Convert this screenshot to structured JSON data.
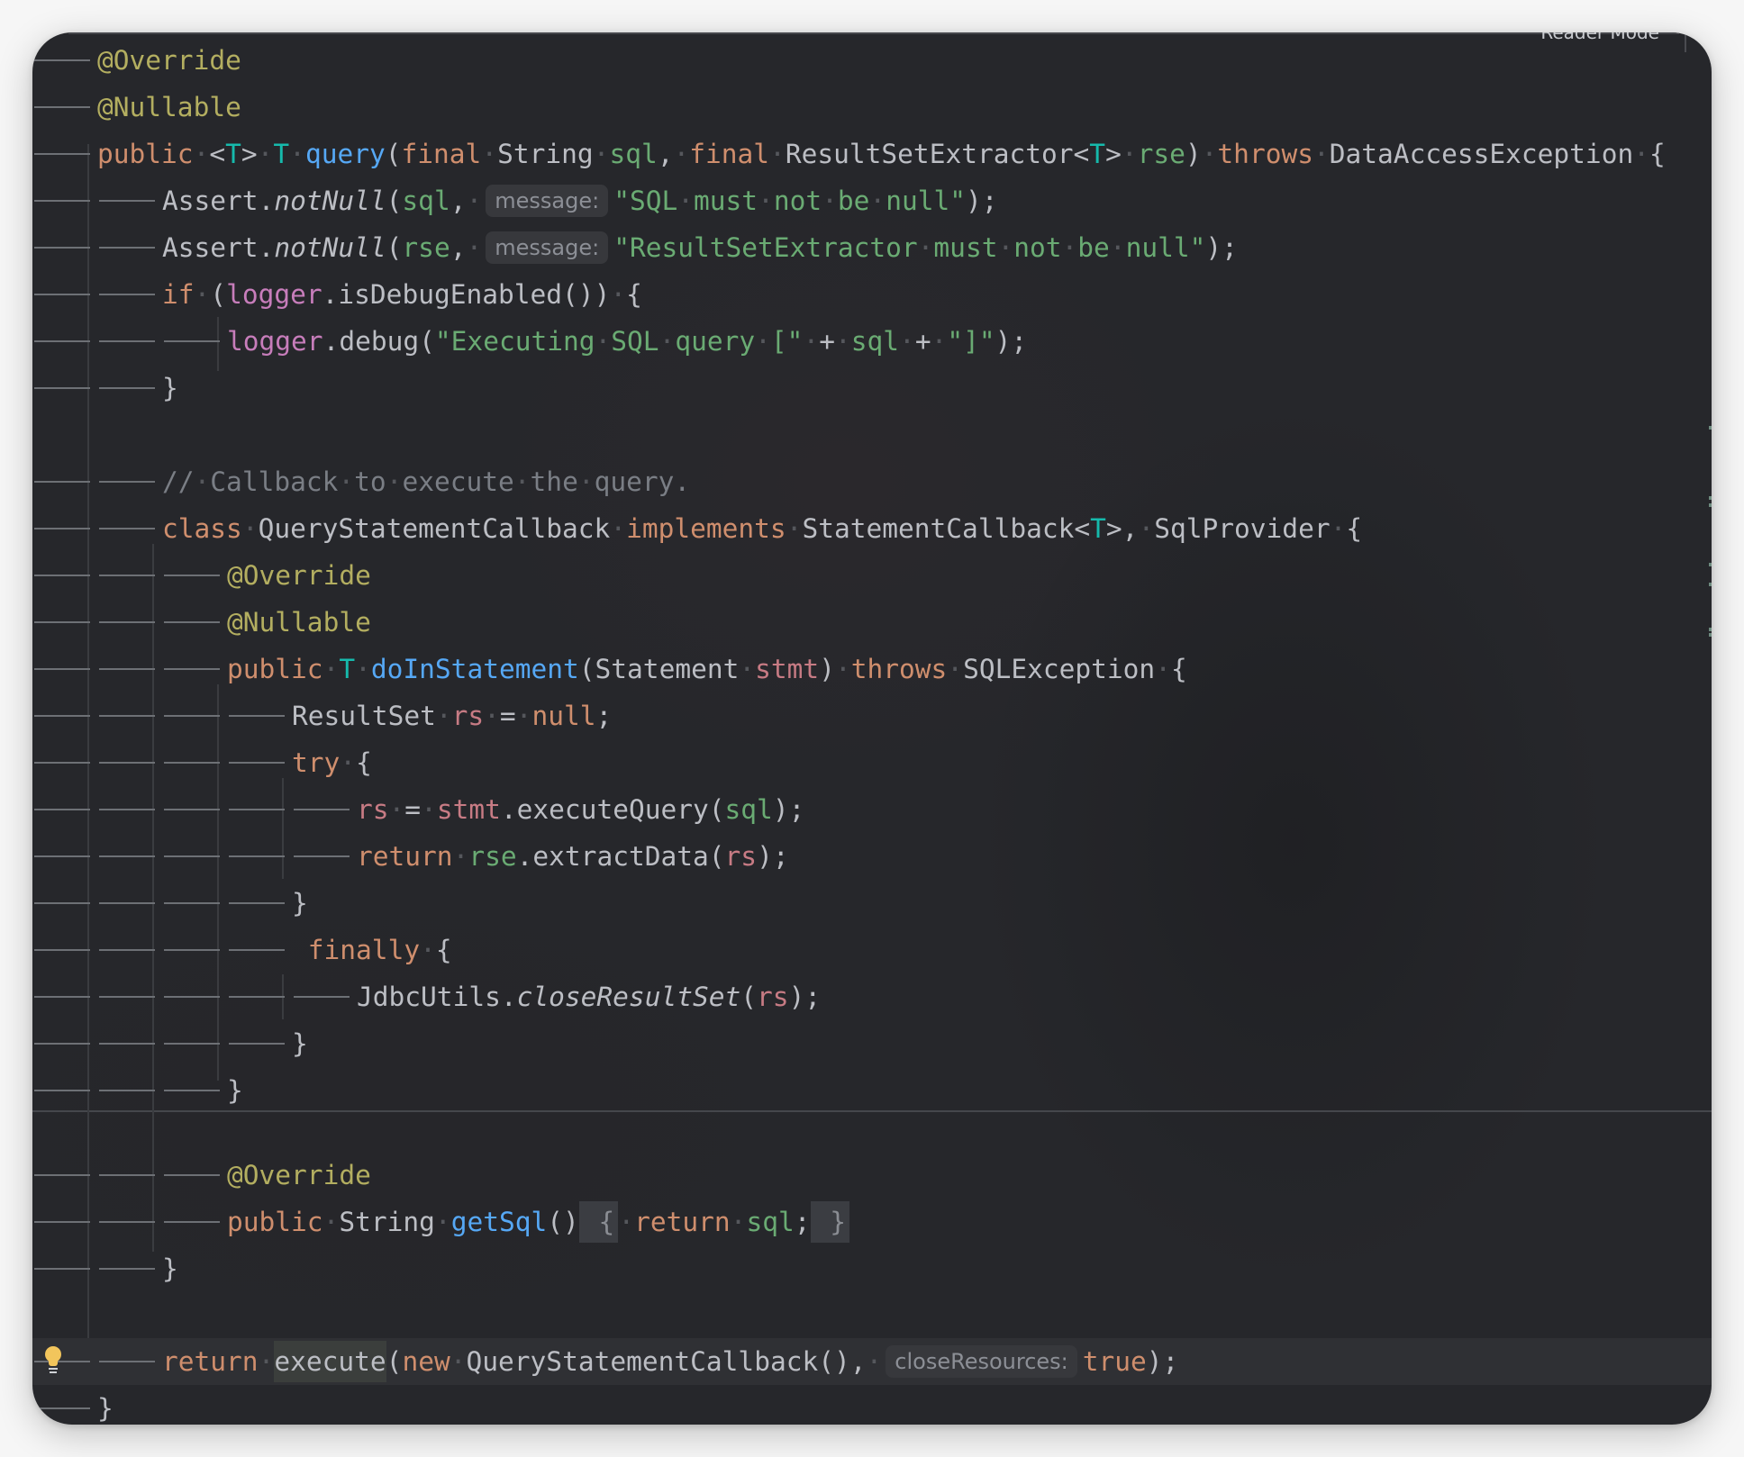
{
  "editor": {
    "reader_mode_label": "Reader Mode",
    "language": "Java",
    "whitespace_glyph": "·",
    "lines": [
      {
        "indent": 1,
        "tokens": [
          [
            "ann",
            "@Override"
          ]
        ]
      },
      {
        "indent": 1,
        "tokens": [
          [
            "ann",
            "@Nullable"
          ]
        ]
      },
      {
        "indent": 1,
        "tokens": [
          [
            "kw",
            "public"
          ],
          [
            "ws",
            " "
          ],
          [
            "txt",
            "<"
          ],
          [
            "tp",
            "T"
          ],
          [
            "txt",
            ">"
          ],
          [
            "ws",
            " "
          ],
          [
            "tp",
            "T"
          ],
          [
            "ws",
            " "
          ],
          [
            "mdecl",
            "query"
          ],
          [
            "txt",
            "("
          ],
          [
            "kw",
            "final"
          ],
          [
            "ws",
            " "
          ],
          [
            "txt",
            "String"
          ],
          [
            "ws",
            " "
          ],
          [
            "param",
            "sql"
          ],
          [
            "txt",
            ","
          ],
          [
            "ws",
            " "
          ],
          [
            "kw",
            "final"
          ],
          [
            "ws",
            " "
          ],
          [
            "txt",
            "ResultSetExtractor<"
          ],
          [
            "tp",
            "T"
          ],
          [
            "txt",
            ">"
          ],
          [
            "ws",
            " "
          ],
          [
            "param",
            "rse"
          ],
          [
            "txt",
            ")"
          ],
          [
            "ws",
            " "
          ],
          [
            "kw",
            "throws"
          ],
          [
            "ws",
            " "
          ],
          [
            "txt",
            "DataAccessException"
          ],
          [
            "ws",
            " "
          ],
          [
            "txt",
            "{"
          ]
        ]
      },
      {
        "indent": 2,
        "tokens": [
          [
            "txt",
            "Assert."
          ],
          [
            "static",
            "notNull"
          ],
          [
            "txt",
            "("
          ],
          [
            "param",
            "sql"
          ],
          [
            "txt",
            ","
          ],
          [
            "ws",
            " "
          ],
          [
            "hint",
            "message:"
          ],
          [
            "str",
            "\"SQL"
          ],
          [
            "ws",
            " "
          ],
          [
            "str",
            "must"
          ],
          [
            "ws",
            " "
          ],
          [
            "str",
            "not"
          ],
          [
            "ws",
            " "
          ],
          [
            "str",
            "be"
          ],
          [
            "ws",
            " "
          ],
          [
            "str",
            "null\""
          ],
          [
            "txt",
            ");"
          ]
        ]
      },
      {
        "indent": 2,
        "tokens": [
          [
            "txt",
            "Assert."
          ],
          [
            "static",
            "notNull"
          ],
          [
            "txt",
            "("
          ],
          [
            "param",
            "rse"
          ],
          [
            "txt",
            ","
          ],
          [
            "ws",
            " "
          ],
          [
            "hint",
            "message:"
          ],
          [
            "str",
            "\"ResultSetExtractor"
          ],
          [
            "ws",
            " "
          ],
          [
            "str",
            "must"
          ],
          [
            "ws",
            " "
          ],
          [
            "str",
            "not"
          ],
          [
            "ws",
            " "
          ],
          [
            "str",
            "be"
          ],
          [
            "ws",
            " "
          ],
          [
            "str",
            "null\""
          ],
          [
            "txt",
            ");"
          ]
        ]
      },
      {
        "indent": 2,
        "tokens": [
          [
            "kw",
            "if"
          ],
          [
            "ws",
            " "
          ],
          [
            "txt",
            "("
          ],
          [
            "field",
            "logger"
          ],
          [
            "txt",
            ".isDebugEnabled())"
          ],
          [
            "ws",
            " "
          ],
          [
            "txt",
            "{"
          ]
        ]
      },
      {
        "indent": 3,
        "tokens": [
          [
            "field",
            "logger"
          ],
          [
            "txt",
            ".debug("
          ],
          [
            "str",
            "\"Executing"
          ],
          [
            "ws",
            " "
          ],
          [
            "str",
            "SQL"
          ],
          [
            "ws",
            " "
          ],
          [
            "str",
            "query"
          ],
          [
            "ws",
            " "
          ],
          [
            "str",
            "[\""
          ],
          [
            "ws",
            " "
          ],
          [
            "txt",
            "+"
          ],
          [
            "ws",
            " "
          ],
          [
            "param",
            "sql"
          ],
          [
            "ws",
            " "
          ],
          [
            "txt",
            "+"
          ],
          [
            "ws",
            " "
          ],
          [
            "str",
            "\"]\""
          ],
          [
            "txt",
            ");"
          ]
        ]
      },
      {
        "indent": 2,
        "tokens": [
          [
            "txt",
            "}"
          ]
        ]
      },
      {
        "indent": 0,
        "tokens": []
      },
      {
        "indent": 2,
        "tokens": [
          [
            "com",
            "//"
          ],
          [
            "ws",
            " "
          ],
          [
            "com",
            "Callback"
          ],
          [
            "ws",
            " "
          ],
          [
            "com",
            "to"
          ],
          [
            "ws",
            " "
          ],
          [
            "com",
            "execute"
          ],
          [
            "ws",
            " "
          ],
          [
            "com",
            "the"
          ],
          [
            "ws",
            " "
          ],
          [
            "com",
            "query."
          ]
        ]
      },
      {
        "indent": 2,
        "tokens": [
          [
            "kw",
            "class"
          ],
          [
            "ws",
            " "
          ],
          [
            "txt",
            "QueryStatementCallback"
          ],
          [
            "ws",
            " "
          ],
          [
            "kw",
            "implements"
          ],
          [
            "ws",
            " "
          ],
          [
            "txt",
            "StatementCallback<"
          ],
          [
            "tp",
            "T"
          ],
          [
            "txt",
            ">,"
          ],
          [
            "ws",
            " "
          ],
          [
            "txt",
            "SqlProvider"
          ],
          [
            "ws",
            " "
          ],
          [
            "txt",
            "{"
          ]
        ]
      },
      {
        "indent": 3,
        "tokens": [
          [
            "ann",
            "@Override"
          ]
        ]
      },
      {
        "indent": 3,
        "tokens": [
          [
            "ann",
            "@Nullable"
          ]
        ]
      },
      {
        "indent": 3,
        "tokens": [
          [
            "kw",
            "public"
          ],
          [
            "ws",
            " "
          ],
          [
            "tp",
            "T"
          ],
          [
            "ws",
            " "
          ],
          [
            "mdecl",
            "doInStatement"
          ],
          [
            "txt",
            "(Statement"
          ],
          [
            "ws",
            " "
          ],
          [
            "local",
            "stmt"
          ],
          [
            "txt",
            ")"
          ],
          [
            "ws",
            " "
          ],
          [
            "kw",
            "throws"
          ],
          [
            "ws",
            " "
          ],
          [
            "txt",
            "SQLException"
          ],
          [
            "ws",
            " "
          ],
          [
            "txt",
            "{"
          ]
        ]
      },
      {
        "indent": 4,
        "tokens": [
          [
            "txt",
            "ResultSet"
          ],
          [
            "ws",
            " "
          ],
          [
            "local",
            "rs"
          ],
          [
            "ws",
            " "
          ],
          [
            "txt",
            "="
          ],
          [
            "ws",
            " "
          ],
          [
            "kw",
            "null"
          ],
          [
            "txt",
            ";"
          ]
        ]
      },
      {
        "indent": 4,
        "tokens": [
          [
            "kw",
            "try"
          ],
          [
            "ws",
            " "
          ],
          [
            "txt",
            "{"
          ]
        ]
      },
      {
        "indent": 5,
        "tokens": [
          [
            "local",
            "rs"
          ],
          [
            "ws",
            " "
          ],
          [
            "txt",
            "="
          ],
          [
            "ws",
            " "
          ],
          [
            "local",
            "stmt"
          ],
          [
            "txt",
            ".executeQuery("
          ],
          [
            "param",
            "sql"
          ],
          [
            "txt",
            ");"
          ]
        ]
      },
      {
        "indent": 5,
        "tokens": [
          [
            "kw",
            "return"
          ],
          [
            "ws",
            " "
          ],
          [
            "param",
            "rse"
          ],
          [
            "txt",
            ".extractData("
          ],
          [
            "local",
            "rs"
          ],
          [
            "txt",
            ");"
          ]
        ]
      },
      {
        "indent": 4,
        "tokens": [
          [
            "txt",
            "}"
          ]
        ]
      },
      {
        "indent": 4,
        "tokens": [
          [
            "txt",
            " "
          ],
          [
            "kw",
            "finally"
          ],
          [
            "ws",
            " "
          ],
          [
            "txt",
            "{"
          ]
        ]
      },
      {
        "indent": 5,
        "tokens": [
          [
            "txt",
            "JdbcUtils."
          ],
          [
            "static",
            "closeResultSet"
          ],
          [
            "txt",
            "("
          ],
          [
            "local",
            "rs"
          ],
          [
            "txt",
            ");"
          ]
        ]
      },
      {
        "indent": 4,
        "tokens": [
          [
            "txt",
            "}"
          ]
        ]
      },
      {
        "indent": 3,
        "tokens": [
          [
            "txt",
            "}"
          ]
        ]
      },
      {
        "indent": 0,
        "tokens": []
      },
      {
        "indent": 3,
        "tokens": [
          [
            "ann",
            "@Override"
          ]
        ]
      },
      {
        "indent": 3,
        "tokens": [
          [
            "kw",
            "public"
          ],
          [
            "ws",
            " "
          ],
          [
            "txt",
            "String"
          ],
          [
            "ws",
            " "
          ],
          [
            "mdecl",
            "getSql"
          ],
          [
            "txt",
            "()"
          ],
          [
            "fold",
            " {"
          ],
          [
            "ws",
            " "
          ],
          [
            "kw",
            "return"
          ],
          [
            "ws",
            " "
          ],
          [
            "param",
            "sql"
          ],
          [
            "txt",
            ";"
          ],
          [
            "fold",
            " }"
          ]
        ]
      },
      {
        "indent": 2,
        "tokens": [
          [
            "txt",
            "}"
          ]
        ]
      },
      {
        "indent": 0,
        "tokens": []
      },
      {
        "indent": 2,
        "current": true,
        "bulb": true,
        "tokens": [
          [
            "kw",
            "return"
          ],
          [
            "ws",
            " "
          ],
          [
            "sel",
            "execute"
          ],
          [
            "txt",
            "("
          ],
          [
            "kw",
            "new"
          ],
          [
            "ws",
            " "
          ],
          [
            "txt",
            "QueryStatementCallback(),"
          ],
          [
            "ws",
            " "
          ],
          [
            "hint",
            "closeResources:"
          ],
          [
            "kw",
            "true"
          ],
          [
            "txt",
            ");"
          ]
        ]
      },
      {
        "indent": 1,
        "tokens": [
          [
            "txt",
            "}"
          ]
        ]
      }
    ]
  },
  "colors": {
    "keyword": "#cf8e6d",
    "annotation": "#b3ae60",
    "string": "#6aab73",
    "type_parameter": "#16baac",
    "method_declaration": "#56a8f5",
    "field": "#c77dbb",
    "local_variable": "#c77b84",
    "comment": "#7a7e85",
    "default_text": "#bcbec4",
    "editor_background": "#26272b",
    "current_line": "#2f3034",
    "intention_bulb": "#f2c55c"
  }
}
